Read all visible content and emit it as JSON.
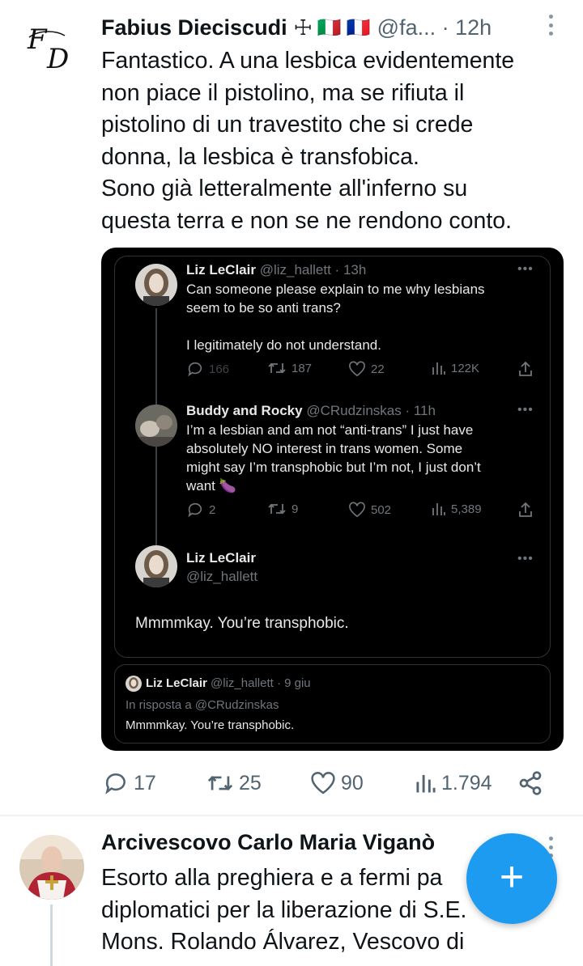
{
  "tweet1": {
    "author_name": "Fabius Dieciscudi",
    "author_symbol": "☩",
    "flags": [
      "🇮🇹",
      "🇫🇷"
    ],
    "handle_time": "@fa... · 12h",
    "avatar_monogram": "FD",
    "text_lines": [
      "Fantastico. A una lesbica evidentemente",
      "non piace il pistolino, ma se rifiuta il",
      "pistolino di un travestito che si crede",
      "donna, la lesbica è transfobica.",
      "Sono già letteralmente all'inferno su",
      "questa terra e non se ne rendono conto."
    ],
    "actions": {
      "replies": "17",
      "retweets": "25",
      "likes": "90",
      "views": "1.794"
    }
  },
  "screenshot": {
    "post1": {
      "name": "Liz LeClair",
      "handle_time": "@liz_hallett · 13h",
      "text_lines": [
        "Can someone please explain to me why lesbians",
        "seem to be so anti trans?",
        "",
        "I legitimately do not understand."
      ],
      "replies": "166",
      "retweets": "187",
      "likes": "22",
      "views": "122K"
    },
    "post2": {
      "name": "Buddy and Rocky",
      "handle_time": "@CRudzinskas · 11h",
      "text_lines": [
        "I’m a lesbian and am not “anti-trans” I just have",
        "absolutely NO interest in trans women.  Some",
        "might say I’m transphobic but I’m not, I just don’t",
        "want 🍆"
      ],
      "replies": "2",
      "retweets": "9",
      "likes": "502",
      "views": "5,389"
    },
    "post3": {
      "name": "Liz LeClair",
      "handle": "@liz_hallett",
      "text": "Mmmmkay. You’re transphobic."
    },
    "quote": {
      "name": "Liz LeClair",
      "handle_date": "@liz_hallett · 9 giu",
      "reply_to": "In risposta a @CRudzinskas",
      "text": "Mmmmkay. You’re transphobic."
    }
  },
  "tweet2": {
    "author_name": "Arcivescovo Carlo Maria Viganò",
    "text_lines": [
      "Esorto alla preghiera e a fermi pa",
      "diplomatici per la liberazione di S.E.",
      "Mons. Rolando Álvarez, Vescovo di"
    ]
  },
  "fab": {
    "label": "+"
  },
  "colors": {
    "accent": "#1d9bf0",
    "text_primary": "#0f1419",
    "text_secondary": "#536471",
    "dark_bg": "#000000",
    "dark_text": "#e7e9ea",
    "dark_secondary": "#71767b"
  }
}
